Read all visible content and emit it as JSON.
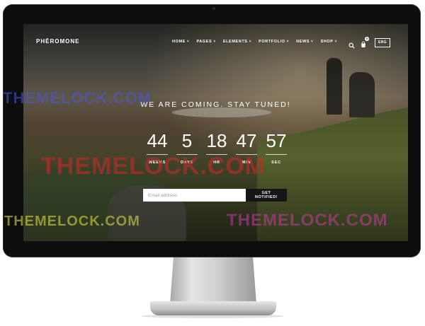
{
  "brand": {
    "logo_text": "PHĒROMONE"
  },
  "nav": {
    "items": [
      {
        "label": "HOME"
      },
      {
        "label": "PAGES"
      },
      {
        "label": "ELEMENTS"
      },
      {
        "label": "PORTFOLIO"
      },
      {
        "label": "NEWS"
      },
      {
        "label": "SHOP"
      }
    ],
    "chevron": "˅",
    "search_icon": "search-icon",
    "cart_icon": "cart-icon",
    "cart_count": "0",
    "language": "ENG"
  },
  "hero": {
    "headline": "WE ARE COMING. STAY TUNED!"
  },
  "countdown": {
    "units": [
      {
        "value": "44",
        "label": "WEEKS"
      },
      {
        "value": "5",
        "label": "DAYS"
      },
      {
        "value": "18",
        "label": "HR"
      },
      {
        "value": "47",
        "label": "MIN"
      },
      {
        "value": "57",
        "label": "SEC"
      }
    ]
  },
  "subscribe": {
    "email_placeholder": "Email address",
    "email_value": "",
    "button_label": "GET NOTIFIED!"
  },
  "watermarks": [
    "THEMELOCK.COM",
    "THEMELOCK.COM",
    "THEMELOCK.COM",
    "THEMELOCK.COM"
  ],
  "colors": {
    "button_bg": "#151515",
    "text_on_hero": "#ffffff",
    "bezel": "#0d0d0d"
  }
}
